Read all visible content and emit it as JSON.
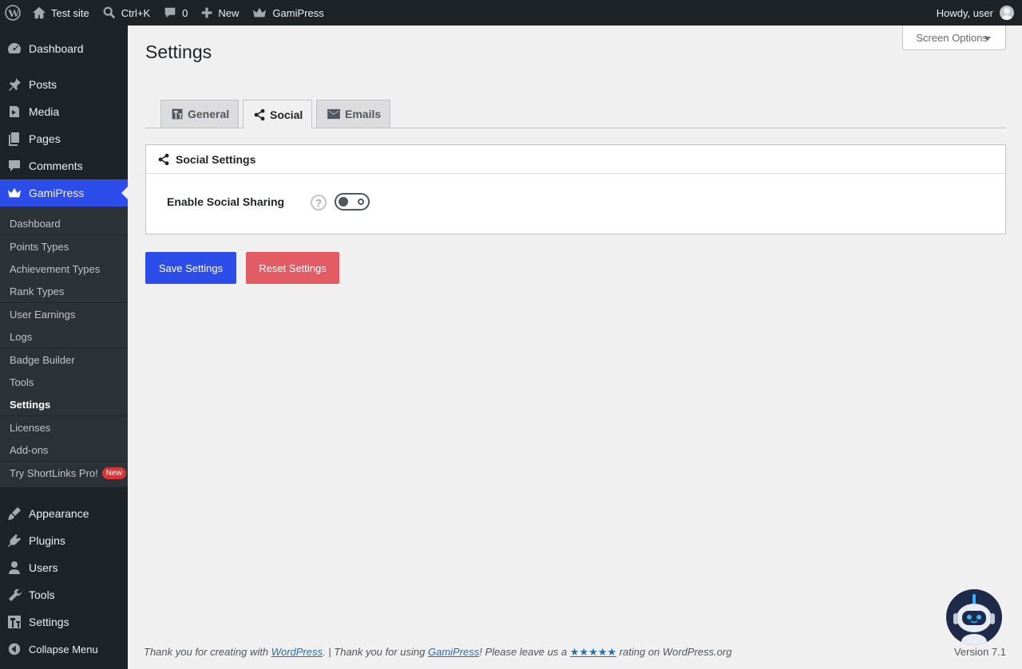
{
  "adminbar": {
    "site_name": "Test site",
    "search_shortcut": "Ctrl+K",
    "comments_count": "0",
    "new_label": "New",
    "gamipress_label": "GamiPress",
    "howdy": "Howdy, user"
  },
  "sidebar": {
    "items": [
      {
        "label": "Dashboard",
        "icon": "dashboard-icon"
      },
      {
        "label": "Posts",
        "icon": "pin-icon"
      },
      {
        "label": "Media",
        "icon": "media-icon"
      },
      {
        "label": "Pages",
        "icon": "pages-icon"
      },
      {
        "label": "Comments",
        "icon": "comment-icon"
      },
      {
        "label": "GamiPress",
        "icon": "crown-icon"
      }
    ],
    "submenu": [
      "Dashboard",
      "Points Types",
      "Achievement Types",
      "Rank Types",
      "User Earnings",
      "Logs",
      "Badge Builder",
      "Tools",
      "Settings",
      "Licenses",
      "Add-ons",
      "Try ShortLinks Pro!"
    ],
    "new_badge": "New",
    "items2": [
      {
        "label": "Appearance",
        "icon": "brush-icon"
      },
      {
        "label": "Plugins",
        "icon": "plugin-icon"
      },
      {
        "label": "Users",
        "icon": "user-icon"
      },
      {
        "label": "Tools",
        "icon": "wrench-icon"
      },
      {
        "label": "Settings",
        "icon": "settings-icon"
      }
    ],
    "collapse": "Collapse Menu"
  },
  "page": {
    "title": "Settings",
    "screen_options": "Screen Options",
    "tabs": [
      "General",
      "Social",
      "Emails"
    ],
    "panel_title": "Social Settings",
    "field_label": "Enable Social Sharing",
    "help_glyph": "?",
    "save_button": "Save Settings",
    "reset_button": "Reset Settings"
  },
  "footer": {
    "t1": "Thank you for creating with ",
    "link1": "WordPress",
    "t2": ". | Thank you for using ",
    "link2": "GamiPress",
    "t3": "! Please leave us a ",
    "stars": "★★★★★",
    "t4": " rating on WordPress.org",
    "version": "Version 7.1"
  },
  "colors": {
    "accent": "#2c4dea",
    "reset": "#e35b63",
    "sidebar_bg": "#1d2327"
  }
}
